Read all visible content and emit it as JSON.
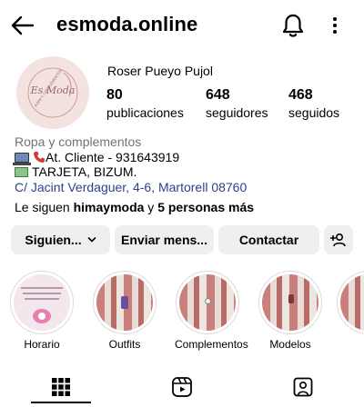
{
  "header": {
    "username": "esmoda.online"
  },
  "profile": {
    "full_name": "Roser Pueyo Pujol",
    "stats": [
      {
        "value": "80",
        "label": "publicaciones"
      },
      {
        "value": "648",
        "label": "seguidores"
      },
      {
        "value": "468",
        "label": "seguidos"
      }
    ],
    "avatar_logo": {
      "initials": "Es Moda",
      "ring_text": "ROPA Y COMPLEMENTOS"
    }
  },
  "bio": {
    "category": "Ropa y complementos",
    "line1": "At. Cliente - 931643919",
    "line2": "TARJETA, BIZUM.",
    "address": "C/ Jacint Verdaguer, 4-6, Martorell 08760"
  },
  "followed_by": {
    "prefix": "Le siguen ",
    "user": "himaymoda",
    "middle": " y ",
    "others": "5 personas más"
  },
  "buttons": {
    "follow": "Siguien...",
    "message": "Enviar mens...",
    "contact": "Contactar"
  },
  "highlights": [
    {
      "label": "Horario"
    },
    {
      "label": "Outfits"
    },
    {
      "label": "Complementos"
    },
    {
      "label": "Modelos"
    },
    {
      "label": ""
    }
  ],
  "colors": {
    "link": "#2f3f8a",
    "button_bg": "#efefef",
    "muted": "#737373",
    "avatar_bg": "#f4e2e0"
  },
  "icons": [
    "back-arrow-icon",
    "bell-icon",
    "more-vertical-icon",
    "add-person-icon",
    "grid-icon",
    "reels-icon",
    "tagged-icon"
  ]
}
